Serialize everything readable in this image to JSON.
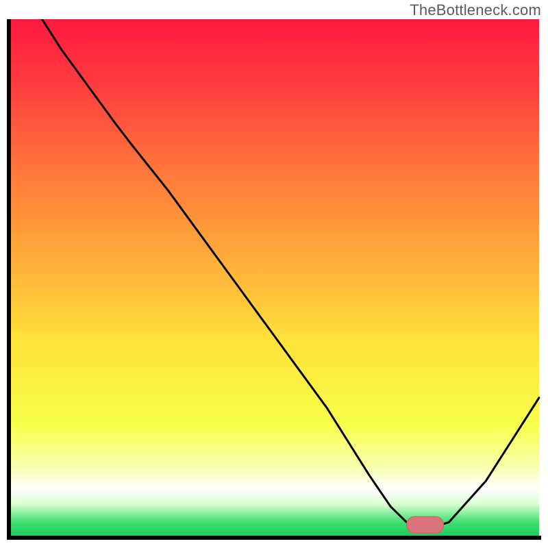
{
  "watermark": "TheBottleneck.com",
  "colors": {
    "axis": "#000000",
    "curve": "#000000",
    "marker_fill": "#d9747a",
    "marker_stroke": "#cc5d63",
    "gradient_stops": [
      {
        "offset": 0.0,
        "color": "#ff1a3d"
      },
      {
        "offset": 0.12,
        "color": "#ff3a3f"
      },
      {
        "offset": 0.3,
        "color": "#ff7a3a"
      },
      {
        "offset": 0.48,
        "color": "#ffb23a"
      },
      {
        "offset": 0.62,
        "color": "#ffe23a"
      },
      {
        "offset": 0.78,
        "color": "#f7ff4a"
      },
      {
        "offset": 0.86,
        "color": "#f8ffa8"
      },
      {
        "offset": 0.905,
        "color": "#ffffff"
      },
      {
        "offset": 0.935,
        "color": "#d9ffd0"
      },
      {
        "offset": 0.97,
        "color": "#3fe070"
      },
      {
        "offset": 1.0,
        "color": "#18c858"
      }
    ]
  },
  "chart_data": {
    "type": "line",
    "title": "",
    "xlabel": "",
    "ylabel": "",
    "xlim": [
      0,
      100
    ],
    "ylim": [
      0,
      100
    ],
    "grid": false,
    "legend": false,
    "x": [
      0,
      5,
      10,
      15,
      20,
      23,
      30,
      40,
      50,
      60,
      68,
      72,
      75,
      80,
      83,
      90,
      100
    ],
    "series": [
      {
        "name": "bottleneck-curve",
        "values": [
          110,
          102,
          94,
          87,
          80,
          76,
          67,
          53,
          39,
          25,
          12,
          6,
          3,
          2,
          3,
          11,
          27
        ]
      }
    ],
    "marker": {
      "x_range": [
        75,
        82
      ],
      "y": 2.5,
      "thickness": 3.2
    },
    "annotations": []
  }
}
